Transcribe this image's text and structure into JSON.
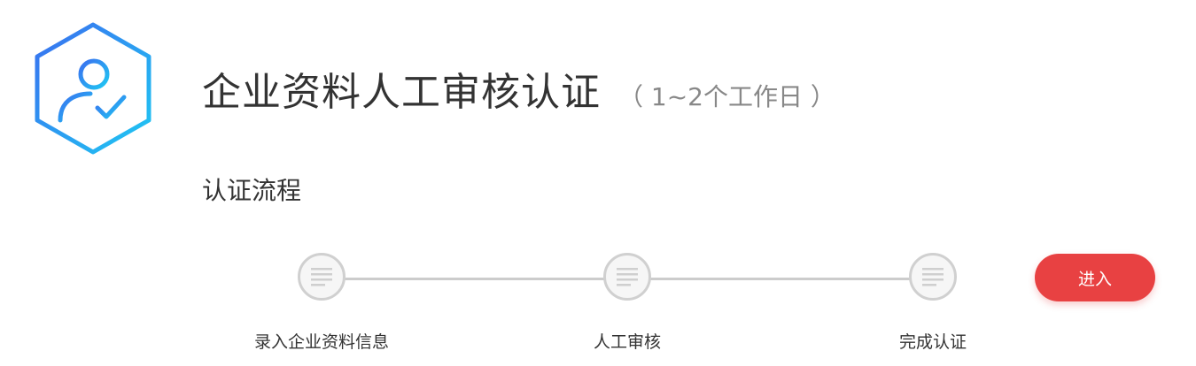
{
  "header": {
    "title": "企业资料人工审核认证",
    "subtitle": "（ 1~2个工作日 ）",
    "logo_icon": "user-verified-hexagon-icon"
  },
  "section": {
    "title": "认证流程"
  },
  "steps": [
    {
      "label": "录入企业资料信息",
      "icon": "list-icon"
    },
    {
      "label": "人工审核",
      "icon": "list-icon"
    },
    {
      "label": "完成认证",
      "icon": "list-icon"
    }
  ],
  "actions": {
    "enter_label": "进入"
  },
  "colors": {
    "accent": "#e84142",
    "logo_gradient_start": "#3a7af0",
    "logo_gradient_end": "#22c3f0",
    "step_line": "#cccccc",
    "step_circle_border": "#d0d0d0"
  }
}
